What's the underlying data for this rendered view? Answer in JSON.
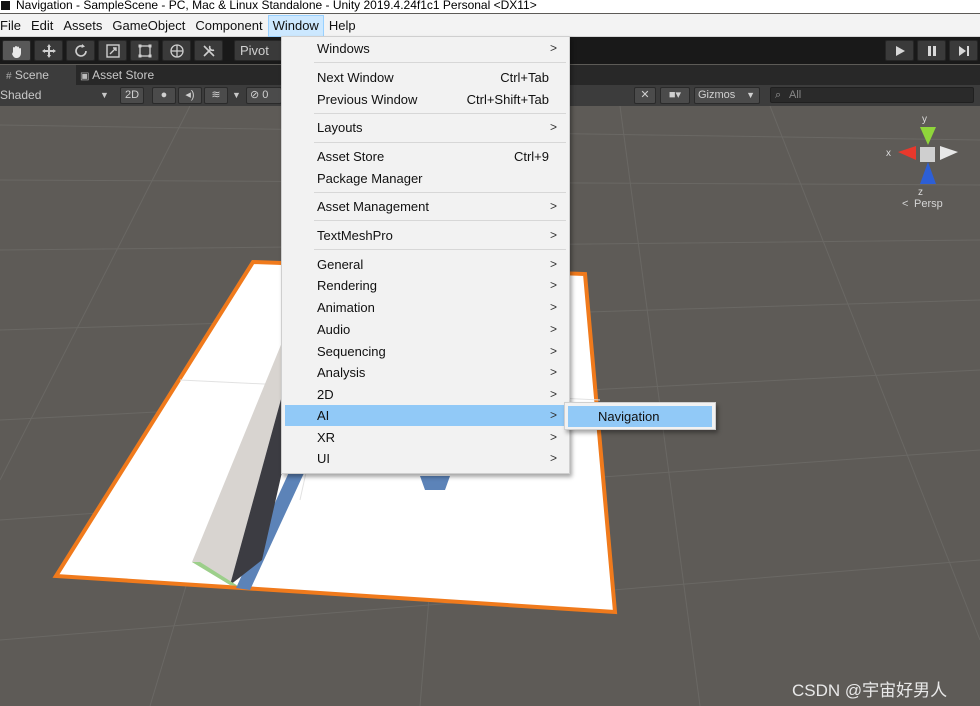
{
  "window": {
    "title": "Navigation - SampleScene - PC, Mac & Linux Standalone - Unity 2019.4.24f1c1 Personal <DX11>"
  },
  "menubar": {
    "items": [
      "File",
      "Edit",
      "Assets",
      "GameObject",
      "Component",
      "Window",
      "Help"
    ],
    "active": "Window"
  },
  "toolbar": {
    "tools": [
      "hand-tool",
      "move-tool",
      "rotate-tool",
      "scale-tool",
      "rect-tool",
      "transform-tool",
      "custom-tool"
    ],
    "pivot_label": "Pivot",
    "play": [
      "play",
      "pause",
      "step"
    ]
  },
  "tabs": {
    "scene": "Scene",
    "asset_store": "Asset Store"
  },
  "scene_toolbar": {
    "draw_mode": "Shaded",
    "mode_2d": "2D",
    "hidden_count": "0",
    "gizmos": "Gizmos",
    "search_placeholder": "All"
  },
  "window_menu": {
    "items": [
      {
        "label": "Windows",
        "shortcut": "",
        "submenu": true
      },
      {
        "label": "Next Window",
        "shortcut": "Ctrl+Tab",
        "submenu": false
      },
      {
        "label": "Previous Window",
        "shortcut": "Ctrl+Shift+Tab",
        "submenu": false
      },
      {
        "label": "Layouts",
        "shortcut": "",
        "submenu": true
      },
      {
        "label": "Asset Store",
        "shortcut": "Ctrl+9",
        "submenu": false
      },
      {
        "label": "Package Manager",
        "shortcut": "",
        "submenu": false
      },
      {
        "label": "Asset Management",
        "shortcut": "",
        "submenu": true
      },
      {
        "label": "TextMeshPro",
        "shortcut": "",
        "submenu": true
      },
      {
        "label": "General",
        "shortcut": "",
        "submenu": true
      },
      {
        "label": "Rendering",
        "shortcut": "",
        "submenu": true
      },
      {
        "label": "Animation",
        "shortcut": "",
        "submenu": true
      },
      {
        "label": "Audio",
        "shortcut": "",
        "submenu": true
      },
      {
        "label": "Sequencing",
        "shortcut": "",
        "submenu": true
      },
      {
        "label": "Analysis",
        "shortcut": "",
        "submenu": true
      },
      {
        "label": "2D",
        "shortcut": "",
        "submenu": true
      },
      {
        "label": "AI",
        "shortcut": "",
        "submenu": true
      },
      {
        "label": "XR",
        "shortcut": "",
        "submenu": true
      },
      {
        "label": "UI",
        "shortcut": "",
        "submenu": true
      }
    ],
    "highlighted": "AI"
  },
  "ai_submenu": {
    "items": [
      {
        "label": "Navigation"
      }
    ]
  },
  "gizmo": {
    "x": "x",
    "y": "y",
    "z": "z",
    "projection": "Persp"
  },
  "watermark": "CSDN @宇宙好男人",
  "colors": {
    "highlight": "#91c9f7",
    "selection_outline": "#f07a1c",
    "scene_background": "#5e5b57",
    "menu_background": "#f2f2f2"
  }
}
